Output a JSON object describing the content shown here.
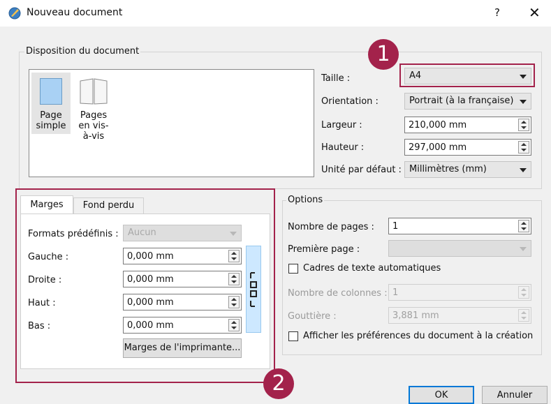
{
  "window": {
    "title": "Nouveau document",
    "help": "?",
    "close": "✕"
  },
  "layout_group": {
    "legend": "Disposition du document",
    "options": [
      {
        "label": "Page\nsimple",
        "selected": true
      },
      {
        "label": "Pages\nen vis-\nà-vis",
        "selected": false
      }
    ]
  },
  "fields": {
    "size_label": "Taille :",
    "size_value": "A4",
    "orientation_label": "Orientation :",
    "orientation_value": "Portrait (à la française)",
    "width_label": "Largeur :",
    "width_value": "210,000 mm",
    "height_label": "Hauteur :",
    "height_value": "297,000 mm",
    "unit_label": "Unité par défaut :",
    "unit_value": "Millimètres (mm)"
  },
  "margins": {
    "tabs": [
      {
        "label": "Marges",
        "active": true
      },
      {
        "label": "Fond perdu",
        "active": false
      }
    ],
    "preset_label": "Formats prédéfinis :",
    "preset_value": "Aucun",
    "left_label": "Gauche :",
    "left_value": "0,000 mm",
    "right_label": "Droite :",
    "right_value": "0,000 mm",
    "top_label": "Haut :",
    "top_value": "0,000 mm",
    "bottom_label": "Bas :",
    "bottom_value": "0,000 mm",
    "printer_button": "Marges de l'imprimante..."
  },
  "options": {
    "legend": "Options",
    "pages_label": "Nombre de pages :",
    "pages_value": "1",
    "first_page_label": "Première page :",
    "first_page_value": "",
    "auto_frames_label": "Cadres de texte automatiques",
    "auto_frames_checked": false,
    "columns_label": "Nombre de colonnes :",
    "columns_value": "1",
    "gutter_label": "Gouttière :",
    "gutter_value": "3,881 mm",
    "show_prefs_label": "Afficher les préférences du document à la création",
    "show_prefs_checked": false
  },
  "buttons": {
    "ok": "OK",
    "cancel": "Annuler"
  },
  "annotations": {
    "marker1": "1",
    "marker2": "2"
  },
  "colors": {
    "accent": "#a3224b",
    "selection": "#cde8ff",
    "default_button": "#0078d7"
  }
}
